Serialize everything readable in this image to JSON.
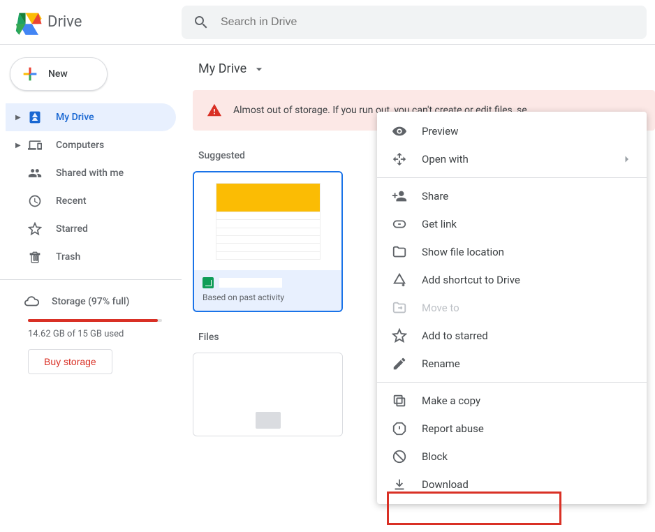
{
  "header": {
    "app_title": "Drive",
    "search_placeholder": "Search in Drive"
  },
  "sidebar": {
    "new_label": "New",
    "items": [
      {
        "label": "My Drive",
        "has_caret": true,
        "active": true
      },
      {
        "label": "Computers",
        "has_caret": true,
        "active": false
      },
      {
        "label": "Shared with me",
        "has_caret": false,
        "active": false
      },
      {
        "label": "Recent",
        "has_caret": false,
        "active": false
      },
      {
        "label": "Starred",
        "has_caret": false,
        "active": false
      },
      {
        "label": "Trash",
        "has_caret": false,
        "active": false
      }
    ],
    "storage_label": "Storage (97% full)",
    "storage_used": "14.62 GB of 15 GB used",
    "buy_label": "Buy storage"
  },
  "main": {
    "breadcrumb": "My Drive",
    "alert": "Almost out of storage. If you run out, you can't create or edit files, se",
    "suggested_label": "Suggested",
    "files_label": "Files",
    "suggested_card": {
      "subtitle": "Based on past activity"
    }
  },
  "context_menu": {
    "items": [
      {
        "label": "Preview",
        "icon": "eye"
      },
      {
        "label": "Open with",
        "icon": "open-with",
        "submenu": true
      }
    ],
    "group2": [
      {
        "label": "Share",
        "icon": "person-add"
      },
      {
        "label": "Get link",
        "icon": "link"
      },
      {
        "label": "Show file location",
        "icon": "folder"
      },
      {
        "label": "Add shortcut to Drive",
        "icon": "shortcut"
      },
      {
        "label": "Move to",
        "icon": "move",
        "disabled": true
      },
      {
        "label": "Add to starred",
        "icon": "star"
      },
      {
        "label": "Rename",
        "icon": "pencil"
      }
    ],
    "group3": [
      {
        "label": "Make a copy",
        "icon": "copy"
      },
      {
        "label": "Report abuse",
        "icon": "report"
      },
      {
        "label": "Block",
        "icon": "block"
      },
      {
        "label": "Download",
        "icon": "download"
      }
    ]
  }
}
